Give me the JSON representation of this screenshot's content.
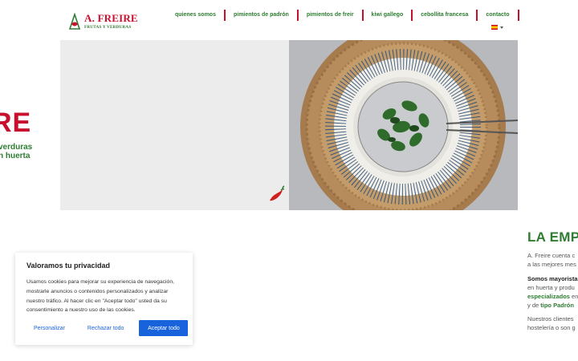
{
  "header": {
    "logo_title": "A. FREIRE",
    "logo_subtitle": "FRUTAS Y VERDURAS",
    "nav": [
      {
        "label": "quienes somos"
      },
      {
        "label": "pimientos de padrón"
      },
      {
        "label": "pimientos de freir"
      },
      {
        "label": "kiwi gallego"
      },
      {
        "label": "cebollita francesa"
      },
      {
        "label": "contacto"
      }
    ],
    "language_icon": "spain-flag-icon"
  },
  "hero": {
    "title_fragment": "RE",
    "line1_fragment": "verduras",
    "line2_fragment": "n huerta"
  },
  "section": {
    "title": "LA EMPR",
    "p1_line1": "A. Freire cuenta c",
    "p1_line2": "a las mejores mes",
    "p2_bold": "Somos mayorista",
    "p2_line2": "en huerta y produ",
    "p2_bold2": "especializados",
    "p2_line3_after": " en",
    "p2_line4_before": "y de ",
    "p2_bold3": "tipo Padrón",
    "p3_line1": "Nuestros clientes",
    "p3_line2": "hostelería o son g"
  },
  "cookie": {
    "title": "Valoramos tu privacidad",
    "text": "Usamos cookies para mejorar su experiencia de navegación, mostrarle anuncios o contenidos personalizados y analizar nuestro tráfico. Al hacer clic en \"Aceptar todo\" usted da su consentimiento a nuestro uso de las cookies.",
    "customize_label": "Personalizar",
    "reject_label": "Rechazar todo",
    "accept_label": "Aceptar todo"
  },
  "colors": {
    "brand_red": "#c8102e",
    "brand_green": "#2e7d32",
    "cookie_blue": "#1863dc"
  }
}
